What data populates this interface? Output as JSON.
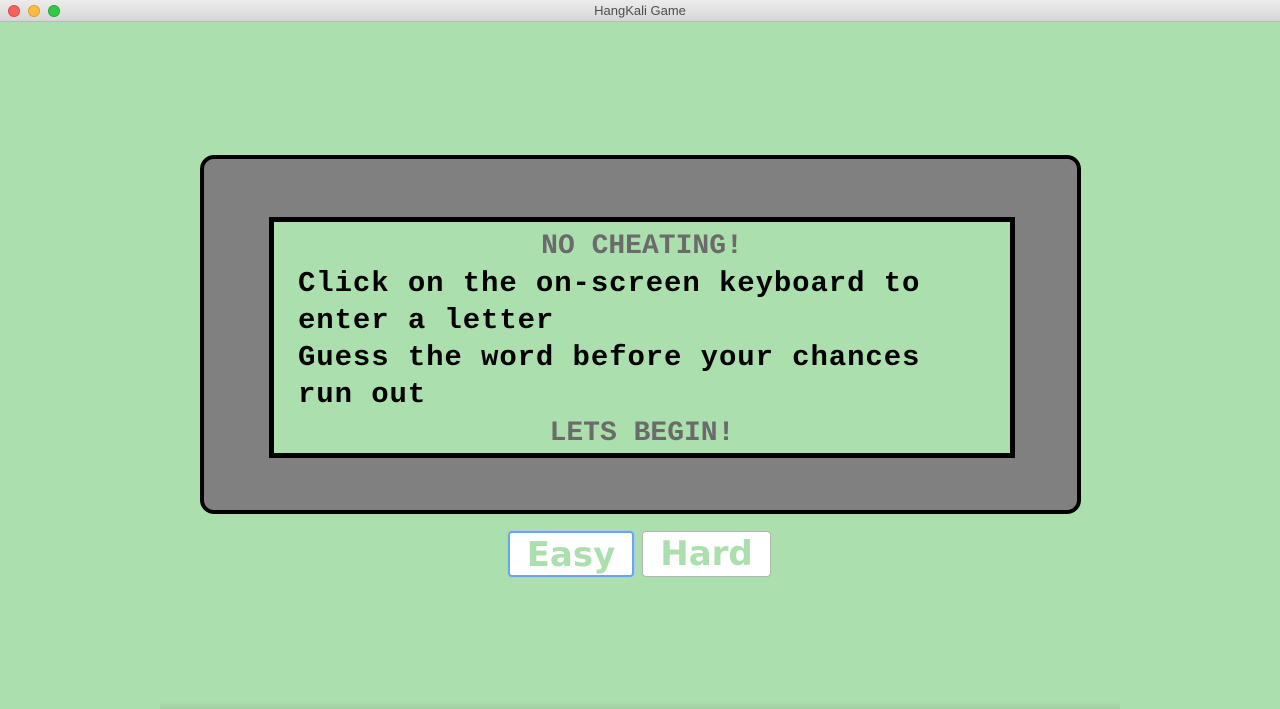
{
  "window": {
    "title": "HangKali Game"
  },
  "panel": {
    "heading_top": "NO CHEATING!",
    "instruction_lines": [
      "Click on the on-screen keyboard to",
      "enter a letter",
      "Guess the word before your chances",
      "run out"
    ],
    "heading_bottom": "LETS BEGIN!"
  },
  "difficulty": {
    "easy_label": "Easy",
    "hard_label": "Hard"
  },
  "colors": {
    "background": "#acdfae",
    "panel_gray": "#808080",
    "heading_gray": "#6b6b6b",
    "focus_blue": "#6aa8e0"
  }
}
